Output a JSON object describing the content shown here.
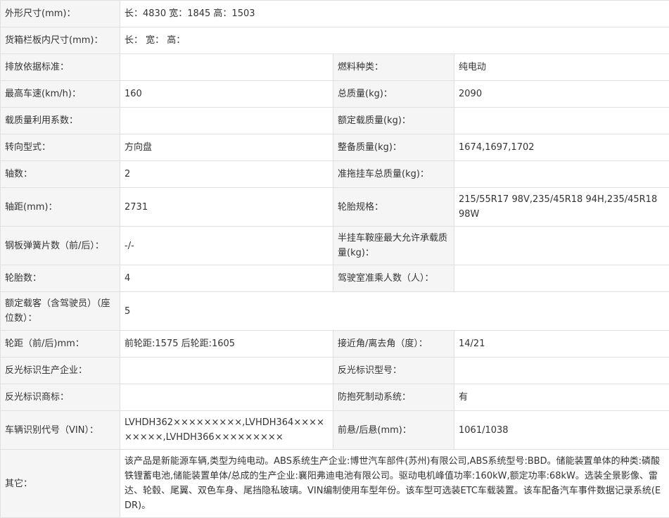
{
  "rows": [
    {
      "l1": "外形尺寸(mm)：",
      "v1": "长：4830 宽：1845 高：1503"
    },
    {
      "l1": "货箱栏板内尺寸(mm)：",
      "v1": "长： 宽： 高："
    },
    {
      "l1": "排放依据标准：",
      "v1": "",
      "l2": "燃料种类：",
      "v2": "纯电动"
    },
    {
      "l1": "最高车速(km/h)：",
      "v1": "160",
      "l2": "总质量(kg)：",
      "v2": "2090"
    },
    {
      "l1": "载质量利用系数：",
      "v1": "",
      "l2": "额定载质量(kg)：",
      "v2": ""
    },
    {
      "l1": "转向型式：",
      "v1": "方向盘",
      "l2": "整备质量(kg)：",
      "v2": "1674,1697,1702"
    },
    {
      "l1": "轴数：",
      "v1": "2",
      "l2": "准拖挂车总质量(kg)：",
      "v2": ""
    },
    {
      "l1": "轴距(mm)：",
      "v1": "2731",
      "l2": "轮胎规格：",
      "v2": "215/55R17 98V,235/45R18 94H,235/45R18 98W"
    },
    {
      "l1": "钢板弹簧片数（前/后）：",
      "v1": "-/-",
      "l2": "半挂车鞍座最大允许承载质量(kg)：",
      "v2": ""
    },
    {
      "l1": "轮胎数：",
      "v1": "4",
      "l2": "驾驶室准乘人数（人）：",
      "v2": ""
    },
    {
      "l1": "额定载客（含驾驶员）（座位数）：",
      "v1": "5"
    },
    {
      "l1": "轮距（前/后)mm：",
      "v1": "前轮距:1575 后轮距:1605",
      "l2": "接近角/离去角（度）：",
      "v2": "14/21"
    },
    {
      "l1": "反光标识生产企业：",
      "v1": "",
      "l2": "反光标识型号：",
      "v2": ""
    },
    {
      "l1": "反光标识商标：",
      "v1": "",
      "l2": "防抱死制动系统：",
      "v2": "有"
    },
    {
      "l1": "车辆识别代号（VIN）：",
      "v1": "LVHDH362×××××××××,LVHDH364×××××××××,LVHDH366×××××××××",
      "l2": "前悬/后悬(mm)：",
      "v2": "1061/1038"
    },
    {
      "l1": "其它：",
      "v1": "该产品是新能源车辆,类型为纯电动。ABS系统生产企业:博世汽车部件(苏州)有限公司,ABS系统型号:BBD。储能装置单体的种类:磷酸铁锂蓄电池,储能装置单体/总成的生产企业:襄阳弗迪电池有限公司。驱动电机峰值功率:160kW,额定功率:68kW。选装全景影像、雷达、轮毂、尾翼、双色车身、尾挡隐私玻璃。VIN编制使用车型年份。该车型可选装ETC车载装置。该车配备汽车事件数据记录系统(EDR)。"
    }
  ]
}
